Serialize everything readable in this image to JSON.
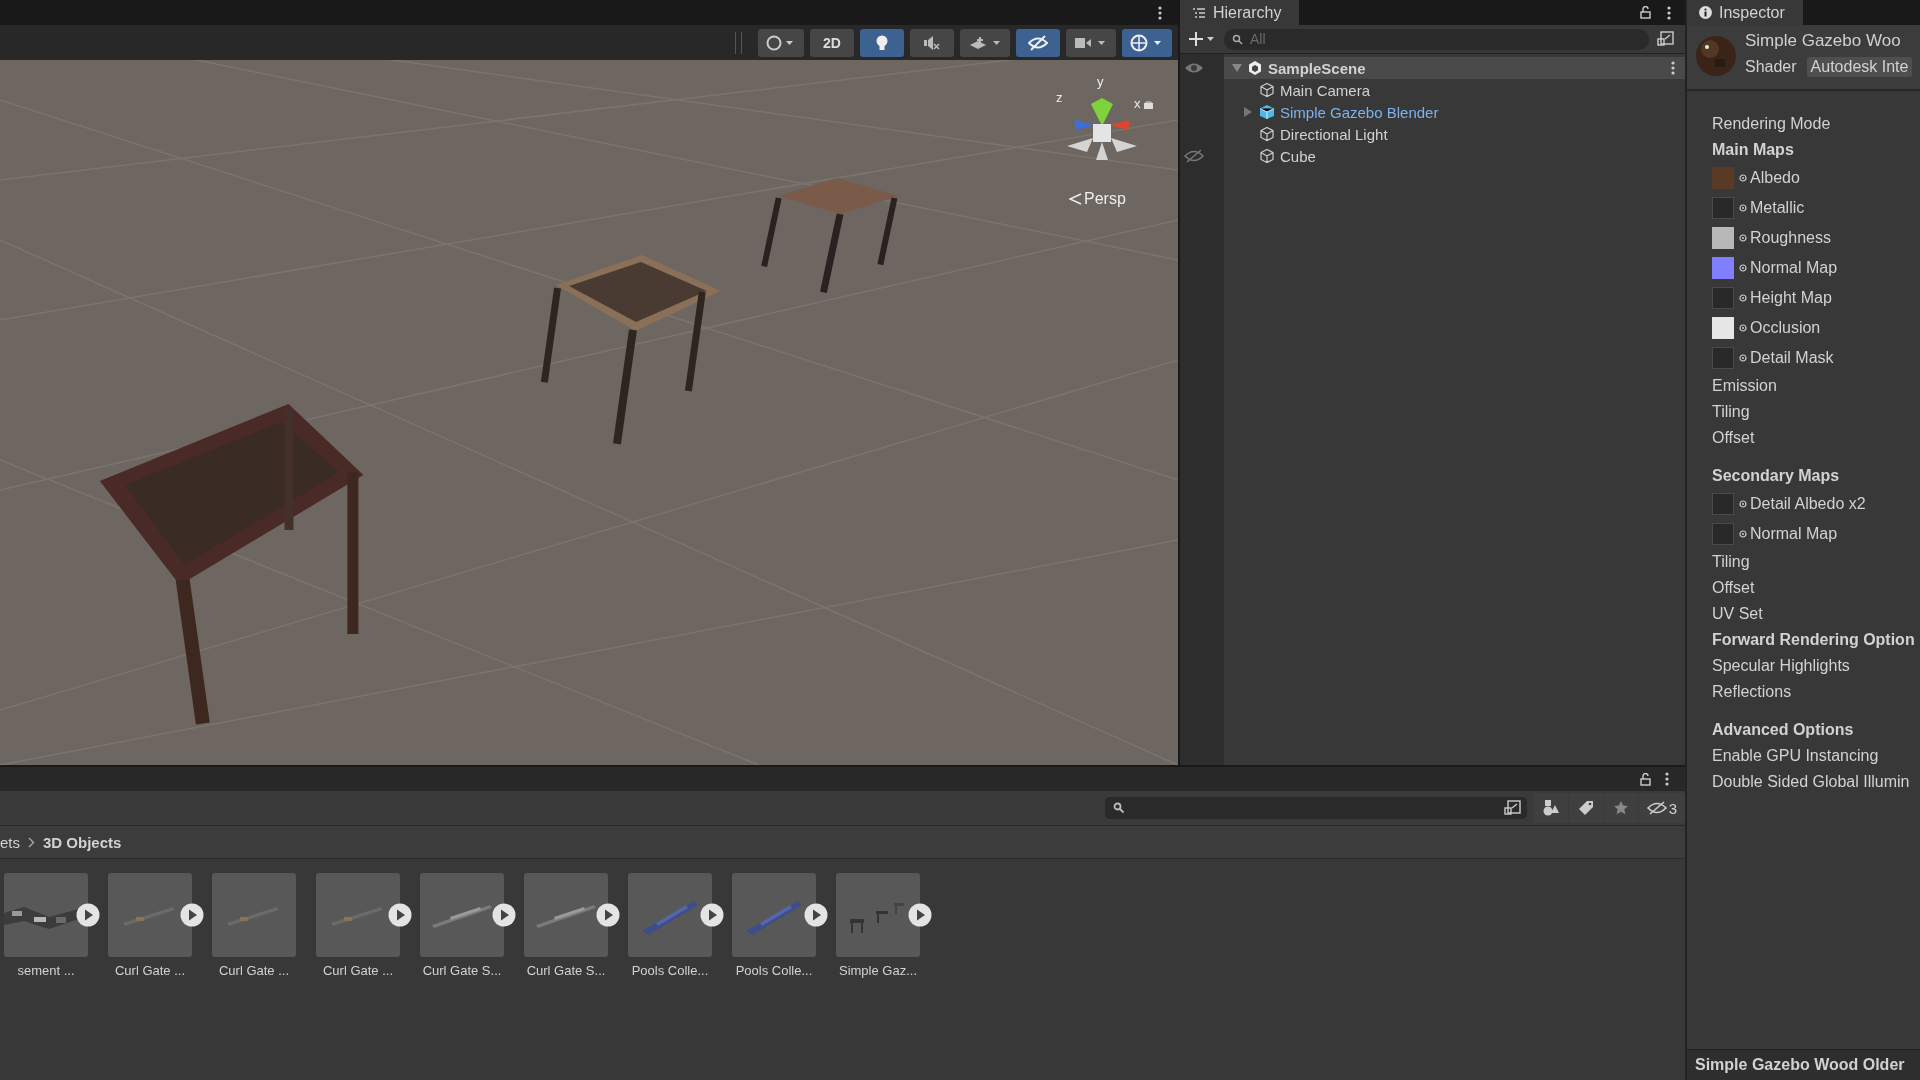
{
  "scene_toolbar": {
    "buttons": [
      {
        "kind": "shading",
        "selected": false
      },
      {
        "kind": "text",
        "label": "2D",
        "selected": false
      },
      {
        "kind": "lighting",
        "selected": true
      },
      {
        "kind": "audio",
        "selected": false
      },
      {
        "kind": "effects",
        "selected": false
      },
      {
        "kind": "visibility",
        "selected": true
      },
      {
        "kind": "camera",
        "selected": false
      },
      {
        "kind": "gizmos",
        "selected": true
      }
    ]
  },
  "scene_view": {
    "axis_labels": [
      "y",
      "z",
      "x"
    ],
    "projection": "Persp"
  },
  "hierarchy": {
    "title": "Hierarchy",
    "search_placeholder": "All",
    "scene": {
      "name": "SampleScene",
      "children": [
        {
          "name": "Main Camera",
          "kind": "object",
          "hidden": false
        },
        {
          "name": "Simple Gazebo Blender",
          "kind": "prefab",
          "hidden": false
        },
        {
          "name": "Directional Light",
          "kind": "object",
          "hidden": false
        },
        {
          "name": "Cube",
          "kind": "object",
          "hidden": true
        }
      ]
    }
  },
  "inspector": {
    "title": "Inspector",
    "material_name": "Simple Gazebo Woo",
    "shader_label": "Shader",
    "shader_value": "Autodesk Inte",
    "sections": [
      {
        "items": [
          {
            "kind": "label",
            "text": "Rendering Mode"
          },
          {
            "kind": "header",
            "text": "Main Maps"
          },
          {
            "kind": "texture",
            "text": "Albedo",
            "color": "#5a3a24"
          },
          {
            "kind": "texture",
            "text": "Metallic"
          },
          {
            "kind": "texture",
            "text": "Roughness",
            "color": "#b8b8b8"
          },
          {
            "kind": "texture",
            "text": "Normal Map",
            "color": "#8080ff"
          },
          {
            "kind": "texture",
            "text": "Height Map"
          },
          {
            "kind": "texture",
            "text": "Occlusion",
            "color": "#e6e6e6"
          },
          {
            "kind": "texture",
            "text": "Detail Mask"
          },
          {
            "kind": "label",
            "text": "Emission"
          },
          {
            "kind": "label",
            "text": "Tiling"
          },
          {
            "kind": "label",
            "text": "Offset"
          }
        ]
      },
      {
        "items": [
          {
            "kind": "header",
            "text": "Secondary Maps"
          },
          {
            "kind": "texture",
            "text": "Detail Albedo x2"
          },
          {
            "kind": "texture",
            "text": "Normal Map"
          },
          {
            "kind": "label",
            "text": "Tiling"
          },
          {
            "kind": "label",
            "text": "Offset"
          },
          {
            "kind": "label",
            "text": "UV Set"
          },
          {
            "kind": "header",
            "text": "Forward Rendering Option"
          },
          {
            "kind": "label",
            "text": "Specular Highlights"
          },
          {
            "kind": "label",
            "text": "Reflections"
          }
        ]
      },
      {
        "items": [
          {
            "kind": "header",
            "text": "Advanced Options"
          },
          {
            "kind": "label",
            "text": "Enable GPU Instancing"
          },
          {
            "kind": "label",
            "text": "Double Sided Global Illumin"
          }
        ]
      }
    ],
    "footer": "Simple Gazebo Wood Older"
  },
  "project": {
    "hidden_count": "3",
    "breadcrumb": [
      "ets",
      "3D Objects"
    ],
    "assets": [
      {
        "label": "sement ...",
        "expandable": true
      },
      {
        "label": "Curl Gate ...",
        "expandable": true
      },
      {
        "label": "Curl Gate ...",
        "expandable": false
      },
      {
        "label": "Curl Gate ...",
        "expandable": true
      },
      {
        "label": "Curl Gate S...",
        "expandable": true
      },
      {
        "label": "Curl Gate S...",
        "expandable": true
      },
      {
        "label": "Pools Colle...",
        "expandable": true
      },
      {
        "label": "Pools Colle...",
        "expandable": true
      },
      {
        "label": "Simple Gaz...",
        "expandable": true
      }
    ]
  }
}
